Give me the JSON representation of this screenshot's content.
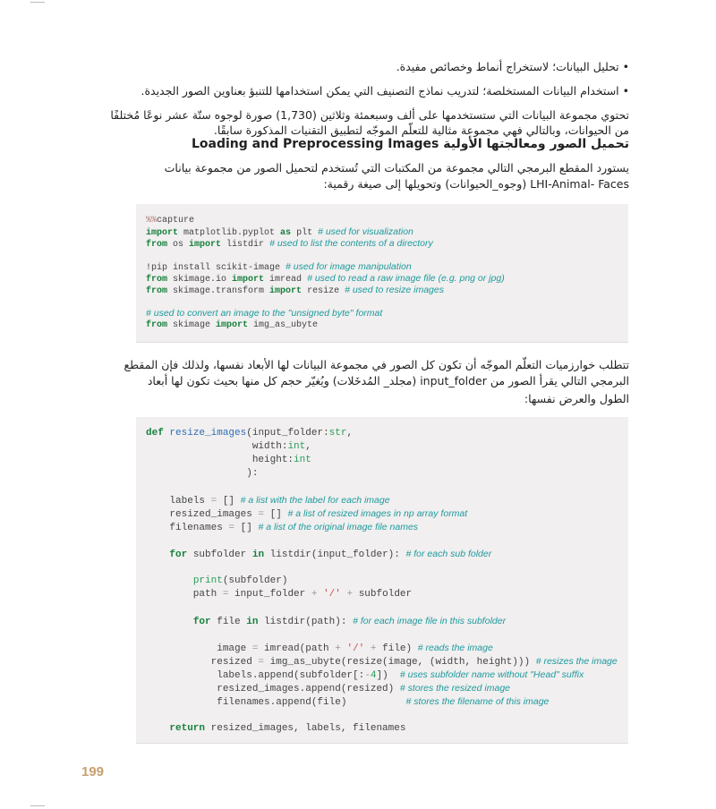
{
  "bullets": [
    "• تحليل البيانات؛ لاستخراج أنماط وخصائص مفيدة.",
    "• استخدام البيانات المستخلصة؛ لتدريب نماذج التصنيف التي يمكن استخدامها للتنبؤ بعناوين الصور الجديدة."
  ],
  "intro_paragraph": [
    "تحتوي مجموعة البيانات التي ستستخدمها على ألف وسبعمئة وثلاثين (1,730) صورة لوجوه ستّة عشر نوعًا مُختلفًا",
    "من الحيوانات، وبالتالي فهي مجموعة مثالية للتعلّم الموجّه لتطبيق التقنيات المذكورة سابقًا."
  ],
  "section_heading": "تحميل الصور ومعالجتها الأولية Loading and Preprocessing Images",
  "loading_paragraph": [
    "يستورد المقطع البرمجي التالي مجموعة من المكتبات التي تُستخدم لتحميل الصور من مجموعة بيانات",
    "LHI-Animal- Faces (وجوه_الحيوانات) وتحويلها إلى صيغة رقمية:"
  ],
  "code_block_1": [
    [
      [
        "mg",
        "%%"
      ],
      [
        "pl",
        "capture"
      ]
    ],
    [
      [
        "kw",
        "import"
      ],
      [
        "pl",
        " matplotlib.pyplot "
      ],
      [
        "kw",
        "as"
      ],
      [
        "pl",
        " plt "
      ],
      [
        "cm",
        "# used for visualization"
      ]
    ],
    [
      [
        "kw",
        "from"
      ],
      [
        "pl",
        " os "
      ],
      [
        "kw",
        "import"
      ],
      [
        "pl",
        " listdir "
      ],
      [
        "cm",
        "# used to list the contents of a directory"
      ]
    ],
    [],
    [
      [
        "pl",
        "!pip install scikit-image "
      ],
      [
        "cm",
        "# used for image manipulation"
      ]
    ],
    [
      [
        "kw",
        "from"
      ],
      [
        "pl",
        " skimage.io "
      ],
      [
        "kw",
        "import"
      ],
      [
        "pl",
        " imread "
      ],
      [
        "cm",
        "# used to read a raw image file (e.g. png or jpg)"
      ]
    ],
    [
      [
        "kw",
        "from"
      ],
      [
        "pl",
        " skimage.transform "
      ],
      [
        "kw",
        "import"
      ],
      [
        "pl",
        " resize "
      ],
      [
        "cm",
        "# used to resize images"
      ]
    ],
    [],
    [
      [
        "cm",
        "# used to convert an image to the \"unsigned byte\" format"
      ]
    ],
    [
      [
        "kw",
        "from"
      ],
      [
        "pl",
        " skimage "
      ],
      [
        "kw",
        "import"
      ],
      [
        "pl",
        " img_as_ubyte"
      ]
    ]
  ],
  "resize_paragraph": [
    "تتطلب خوارزميات التعلّم الموجّه أن تكون كل الصور في مجموعة البيانات لها الأبعاد نفسها، ولذلك فإن المقطع",
    "البرمجي التالي يقرأ الصور من input_folder (مجلد_ المُدخَلات) ويُغيّر حجم كل منها بحيث تكون لها أبعاد",
    "الطول والعرض نفسها:"
  ],
  "code_block_2": [
    [
      [
        "kw",
        "def"
      ],
      [
        "pl",
        " "
      ],
      [
        "fn",
        "resize_images"
      ],
      [
        "pl",
        "(input_folder:"
      ],
      [
        "bi",
        "str"
      ],
      [
        "pl",
        ","
      ]
    ],
    [
      [
        "pl",
        "                  width:"
      ],
      [
        "bi",
        "int"
      ],
      [
        "pl",
        ","
      ]
    ],
    [
      [
        "pl",
        "                  height:"
      ],
      [
        "bi",
        "int"
      ]
    ],
    [
      [
        "pl",
        "                 ):"
      ]
    ],
    [],
    [
      [
        "pl",
        "    labels "
      ],
      [
        "op",
        "="
      ],
      [
        "pl",
        " [] "
      ],
      [
        "cm",
        "# a list with the label for each image"
      ]
    ],
    [
      [
        "pl",
        "    resized_images "
      ],
      [
        "op",
        "="
      ],
      [
        "pl",
        " [] "
      ],
      [
        "cm",
        "# a list of resized images in np array format"
      ]
    ],
    [
      [
        "pl",
        "    filenames "
      ],
      [
        "op",
        "="
      ],
      [
        "pl",
        " [] "
      ],
      [
        "cm",
        "# a list of the original image file names"
      ]
    ],
    [],
    [
      [
        "pl",
        "    "
      ],
      [
        "kw",
        "for"
      ],
      [
        "pl",
        " subfolder "
      ],
      [
        "kw",
        "in"
      ],
      [
        "pl",
        " listdir(input_folder): "
      ],
      [
        "cm",
        "# for each sub folder"
      ]
    ],
    [],
    [
      [
        "pl",
        "        "
      ],
      [
        "bi",
        "print"
      ],
      [
        "pl",
        "(subfolder)"
      ]
    ],
    [
      [
        "pl",
        "        path "
      ],
      [
        "op",
        "="
      ],
      [
        "pl",
        " input_folder "
      ],
      [
        "op",
        "+"
      ],
      [
        "pl",
        " "
      ],
      [
        "st",
        "'/'"
      ],
      [
        "pl",
        " "
      ],
      [
        "op",
        "+"
      ],
      [
        "pl",
        " subfolder"
      ]
    ],
    [],
    [
      [
        "pl",
        "        "
      ],
      [
        "kw",
        "for"
      ],
      [
        "pl",
        " file "
      ],
      [
        "kw",
        "in"
      ],
      [
        "pl",
        " listdir(path): "
      ],
      [
        "cm",
        "# for each image file in this subfolder"
      ]
    ],
    [],
    [
      [
        "pl",
        "            image "
      ],
      [
        "op",
        "="
      ],
      [
        "pl",
        " imread(path "
      ],
      [
        "op",
        "+"
      ],
      [
        "pl",
        " "
      ],
      [
        "st",
        "'/'"
      ],
      [
        "pl",
        " "
      ],
      [
        "op",
        "+"
      ],
      [
        "pl",
        " file) "
      ],
      [
        "cm",
        "# reads the image"
      ]
    ],
    [
      [
        "pl",
        "           resized "
      ],
      [
        "op",
        "="
      ],
      [
        "pl",
        " img_as_ubyte(resize(image, (width, height))) "
      ],
      [
        "cm",
        "# resizes the image"
      ]
    ],
    [
      [
        "pl",
        "            labels.append(subfolder[:"
      ],
      [
        "op",
        "-"
      ],
      [
        "bi",
        "4"
      ],
      [
        "pl",
        "])  "
      ],
      [
        "cm",
        "# uses subfolder name without \"Head\" suffix"
      ]
    ],
    [
      [
        "pl",
        "            resized_images.append(resized) "
      ],
      [
        "cm",
        "# stores the resized image"
      ]
    ],
    [
      [
        "pl",
        "            filenames.append(file)          "
      ],
      [
        "cm",
        "# stores the filename of this image"
      ]
    ],
    [],
    [
      [
        "pl",
        "    "
      ],
      [
        "kw",
        "return"
      ],
      [
        "pl",
        " resized_images, labels, filenames"
      ]
    ]
  ],
  "page_number": "199",
  "colors": {
    "keyword": "#17803d",
    "function": "#2f6db5",
    "comment": "#1e9a9e",
    "string": "#d05050",
    "code_background": "#f1efef",
    "page_number": "#c9a06e"
  }
}
